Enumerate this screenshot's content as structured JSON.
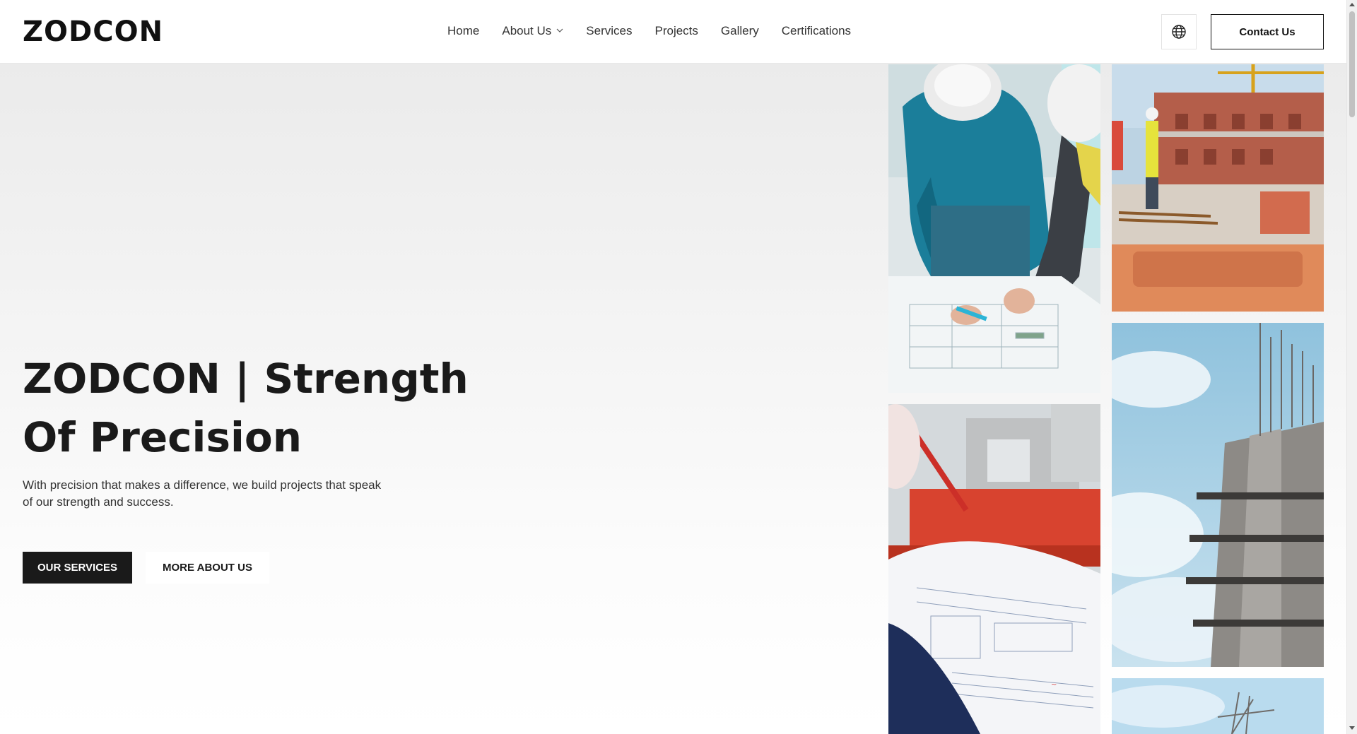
{
  "header": {
    "logo": "ZODCON",
    "nav": [
      {
        "label": "Home"
      },
      {
        "label": "About Us",
        "has_dropdown": true
      },
      {
        "label": "Services"
      },
      {
        "label": "Projects"
      },
      {
        "label": "Gallery"
      },
      {
        "label": "Certifications"
      }
    ],
    "language_icon": "globe-icon",
    "contact_label": "Contact Us"
  },
  "hero": {
    "title": "ZODCON | Strength Of Precision",
    "subtitle": "With precision that makes a difference, we build projects that speak of our strength and success.",
    "primary_button": "OUR SERVICES",
    "secondary_button": "MORE ABOUT US"
  },
  "gallery": {
    "images": [
      {
        "subject": "engineers reviewing blueprints in hard hats"
      },
      {
        "subject": "brick building construction site with crane"
      },
      {
        "subject": "worker holding construction plans near red machinery"
      },
      {
        "subject": "high-rise concrete frame under construction against sky"
      },
      {
        "subject": "scaffolding against blue sky"
      }
    ]
  },
  "colors": {
    "primary": "#1a1a1a",
    "background_top": "#ebebeb",
    "background_bottom": "#ffffff"
  }
}
